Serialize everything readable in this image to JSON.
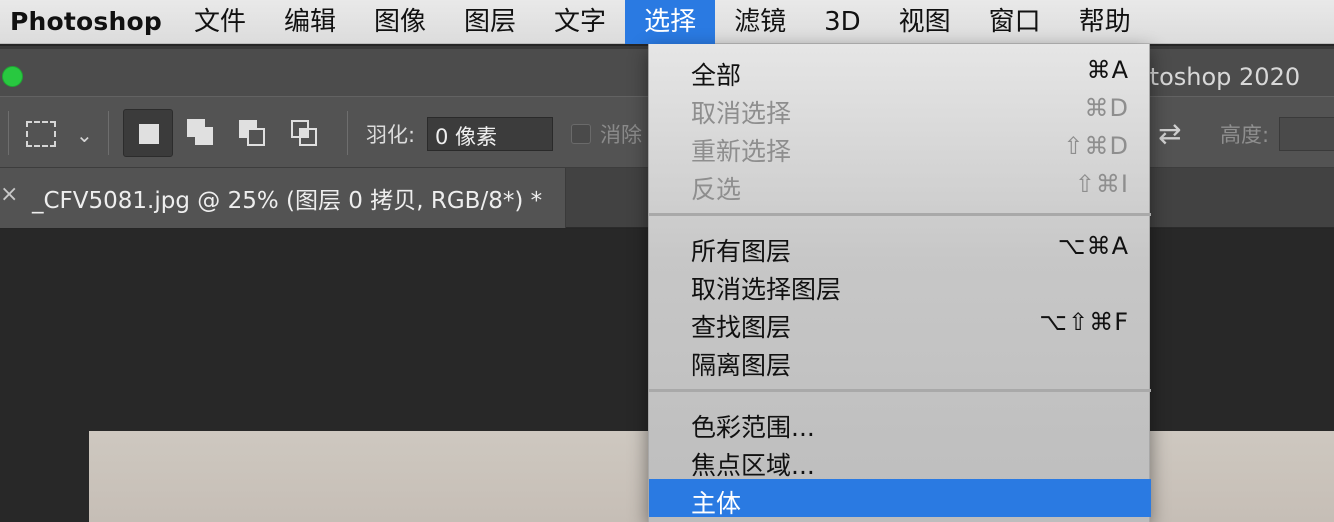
{
  "menubar": {
    "app_name": "Photoshop",
    "items": [
      {
        "label": "文件",
        "active": false
      },
      {
        "label": "编辑",
        "active": false
      },
      {
        "label": "图像",
        "active": false
      },
      {
        "label": "图层",
        "active": false
      },
      {
        "label": "文字",
        "active": false
      },
      {
        "label": "选择",
        "active": true
      },
      {
        "label": "滤镜",
        "active": false
      },
      {
        "label": "3D",
        "active": false
      },
      {
        "label": "视图",
        "active": false
      },
      {
        "label": "窗口",
        "active": false
      },
      {
        "label": "帮助",
        "active": false
      }
    ]
  },
  "window": {
    "title": "otoshop 2020"
  },
  "options": {
    "feather_label": "羽化:",
    "feather_value": "0 像素",
    "antialias_label": "消除",
    "height_label": "高度:"
  },
  "document_tab": {
    "close": "×",
    "title": "_CFV5081.jpg @ 25% (图层 0 拷贝, RGB/8*) *"
  },
  "select_menu": {
    "groups": [
      [
        {
          "label": "全部",
          "shortcut": "⌘A",
          "disabled": false
        },
        {
          "label": "取消选择",
          "shortcut": "⌘D",
          "disabled": true
        },
        {
          "label": "重新选择",
          "shortcut": "⇧⌘D",
          "disabled": true
        },
        {
          "label": "反选",
          "shortcut": "⇧⌘I",
          "disabled": true
        }
      ],
      [
        {
          "label": "所有图层",
          "shortcut": "⌥⌘A",
          "disabled": false
        },
        {
          "label": "取消选择图层",
          "shortcut": "",
          "disabled": false
        },
        {
          "label": "查找图层",
          "shortcut": "⌥⇧⌘F",
          "disabled": false
        },
        {
          "label": "隔离图层",
          "shortcut": "",
          "disabled": false
        }
      ],
      [
        {
          "label": "色彩范围...",
          "shortcut": "",
          "disabled": false
        },
        {
          "label": "焦点区域...",
          "shortcut": "",
          "disabled": false
        },
        {
          "label": "主体",
          "shortcut": "",
          "disabled": false,
          "highlighted": true
        }
      ]
    ]
  },
  "colors": {
    "accent": "#2a7ae2",
    "menubar_bg": "#e2e2e2",
    "ps_panel": "#535353",
    "canvas_bg": "#282828",
    "traffic_green": "#28c840"
  },
  "icons": {
    "marquee": "rectangular-marquee-icon",
    "selection_modes": [
      "new-selection-icon",
      "add-to-selection-icon",
      "subtract-from-selection-icon",
      "intersect-selection-icon"
    ],
    "swap": "swap-arrows-icon"
  }
}
